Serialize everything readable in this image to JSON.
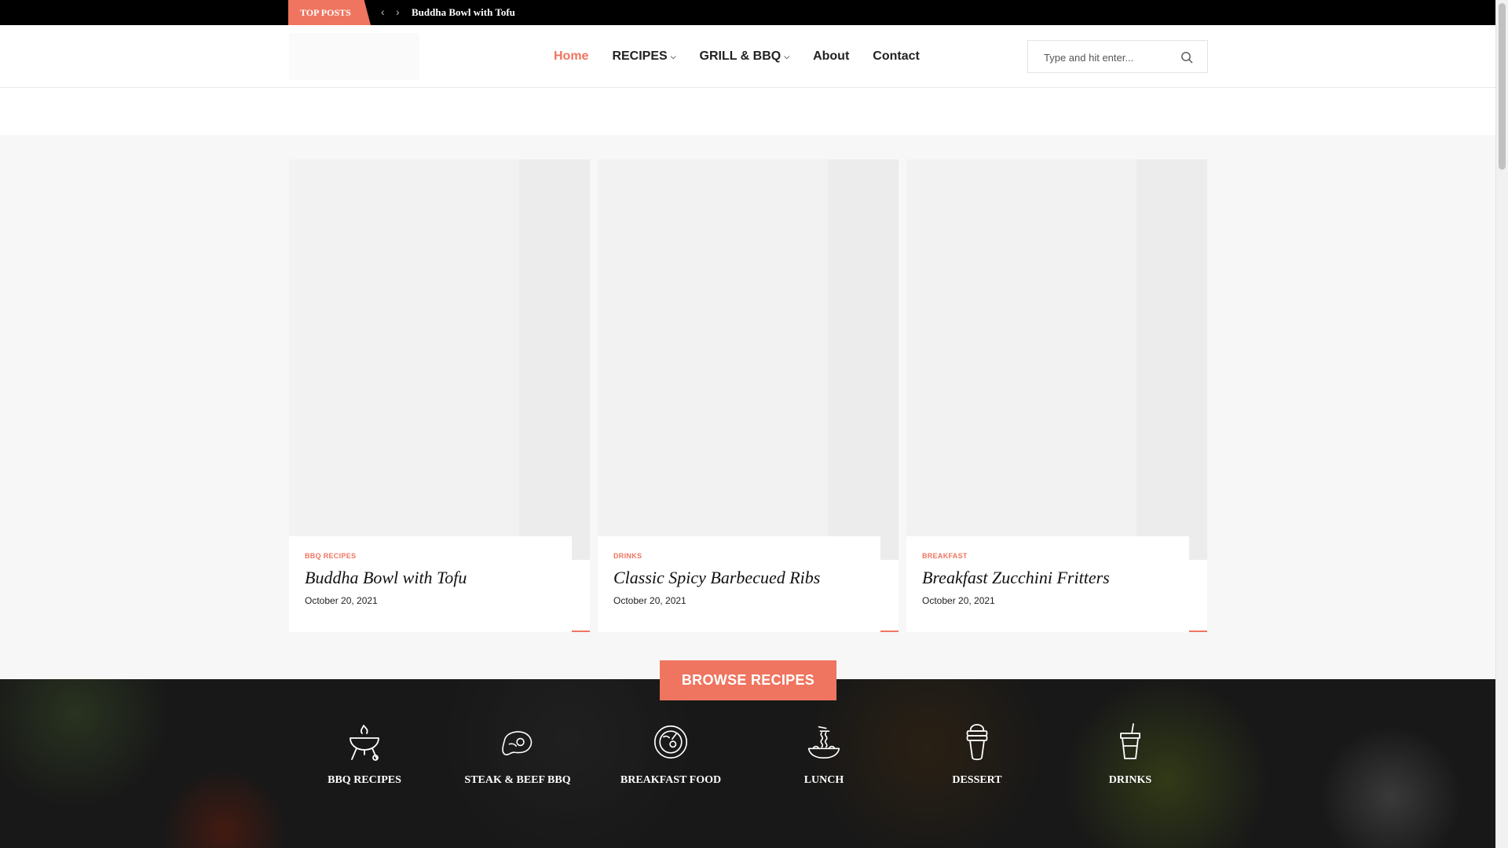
{
  "topbar": {
    "label": "TOP POSTS",
    "prev_arrow": "‹",
    "next_arrow": "›",
    "current_post": "Buddha Bowl with Tofu"
  },
  "header": {
    "nav": [
      {
        "label": "Home",
        "active": true
      },
      {
        "label": "RECIPES",
        "dropdown": true
      },
      {
        "label": "GRILL & BBQ",
        "dropdown": true
      },
      {
        "label": "About"
      },
      {
        "label": "Contact"
      }
    ],
    "search": {
      "placeholder": "Type and hit enter...",
      "value": ""
    }
  },
  "cards": [
    {
      "category": "BBQ RECIPES",
      "title": "Buddha Bowl with Tofu",
      "date": "October 20, 2021"
    },
    {
      "category": "DRINKS",
      "title": "Classic Spicy Barbecued Ribs",
      "date": "October 20, 2021"
    },
    {
      "category": "BREAKFAST",
      "title": "Breakfast Zucchini Fritters",
      "date": "October 20, 2021"
    }
  ],
  "browse": {
    "button_label": "BROWSE RECIPES",
    "categories": [
      {
        "label": "BBQ RECIPES",
        "icon": "grill-icon"
      },
      {
        "label": "STEAK & BEEF BBQ",
        "icon": "steak-icon"
      },
      {
        "label": "BREAKFAST FOOD",
        "icon": "plate-icon"
      },
      {
        "label": "LUNCH",
        "icon": "noodles-icon"
      },
      {
        "label": "DESSERT",
        "icon": "ice-cream-icon"
      },
      {
        "label": "DRINKS",
        "icon": "drink-cup-icon"
      }
    ]
  },
  "colors": {
    "accent": "#ef7560",
    "topbar": "#000000"
  }
}
